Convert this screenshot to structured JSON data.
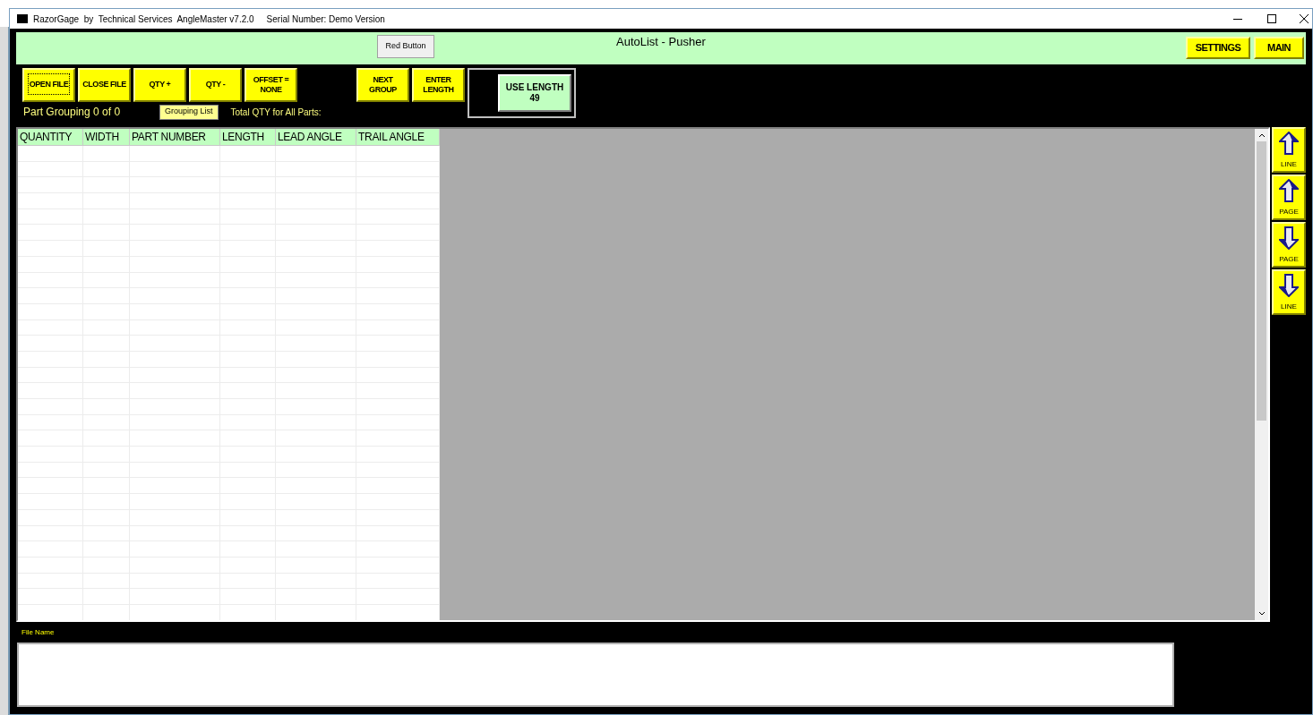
{
  "window": {
    "title": "RazorGage  by  Technical Services  AngleMaster v7.2.0",
    "serial": "Serial Number: Demo Version"
  },
  "header": {
    "red_button": "Red Button",
    "title": "AutoList - Pusher",
    "buttons": [
      "SETTINGS",
      "MAIN"
    ]
  },
  "toolbar": {
    "buttons": [
      {
        "label": "OPEN FILE",
        "focused": true
      },
      {
        "label": "CLOSE FILE",
        "focused": false
      },
      {
        "label": "QTY +",
        "focused": false
      },
      {
        "label": "QTY -",
        "focused": false
      },
      {
        "label": "OFFSET =\nNONE",
        "focused": false
      }
    ],
    "group_buttons": [
      {
        "label": "NEXT\nGROUP"
      },
      {
        "label": "ENTER\nLENGTH"
      }
    ],
    "use_length": "USE LENGTH\n49",
    "part_grouping": "Part Grouping 0 of 0",
    "grouping_list": "Grouping List",
    "total_qty": "Total QTY for All Parts:"
  },
  "table": {
    "columns": [
      "QUANTITY",
      "WIDTH",
      "PART NUMBER",
      "LENGTH",
      "LEAD ANGLE",
      "TRAIL ANGLE"
    ]
  },
  "nav": [
    {
      "label": "LINE",
      "kind": "up"
    },
    {
      "label": "PAGE",
      "kind": "up"
    },
    {
      "label": "PAGE",
      "kind": "down"
    },
    {
      "label": "LINE",
      "kind": "down"
    }
  ],
  "file_name": {
    "label": "File Name"
  }
}
